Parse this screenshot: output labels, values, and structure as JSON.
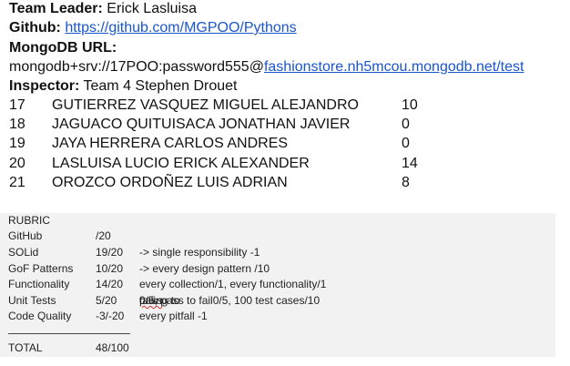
{
  "header": {
    "team_leader_label": "Team Leader:",
    "team_leader_value": " Erick Lasluisa",
    "github_label": "Github:",
    "github_url": "https://github.com/MGPOO/Pythons",
    "mongodb_label": "MongoDB URL:",
    "mongodb_prefix": "mongodb+srv://17POO:password555@",
    "mongodb_link": "fashionstore.nh5mcou.mongodb.net/test",
    "inspector_label": "Inspector:",
    "inspector_value": " Team 4 Stephen Drouet"
  },
  "team": [
    {
      "num": "17",
      "name": "GUTIERREZ VASQUEZ MIGUEL ALEJANDRO",
      "score": "10"
    },
    {
      "num": "18",
      "name": "JAGUACO QUITUISACA JONATHAN JAVIER",
      "score": "0"
    },
    {
      "num": "19",
      "name": "JAYA HERRERA CARLOS ANDRES",
      "score": "0"
    },
    {
      "num": "20",
      "name": "LASLUISA LUCIO ERICK ALEXANDER",
      "score": "14"
    },
    {
      "num": "21",
      "name": "OROZCO ORDOÑEZ LUIS ADRIAN",
      "score": "8"
    }
  ],
  "rubric": {
    "title": "RUBRIC",
    "rows": [
      {
        "label": "GitHub",
        "score": "/20",
        "note": ""
      },
      {
        "label": "SOLid",
        "score": "19/20",
        "note": "-> single responsibility -1"
      },
      {
        "label": "GoF Patterns",
        "score": "10/20",
        "note": "-> every design pattern /10"
      },
      {
        "label": "Functionality",
        "score": "14/20",
        "note": "every collection/1, every functionality/1"
      },
      {
        "label": "Unit Tests",
        "score": "5/20",
        "note_pre": "failing to ",
        "note_squiggle": "pass",
        "note_post": "0/5, pass to fail0/5, 100 test cases/10"
      },
      {
        "label": "Code Quality",
        "score": "-3/-20",
        "note": "every pitfall -1"
      }
    ],
    "total_label": "TOTAL",
    "total_value": "48/100"
  }
}
